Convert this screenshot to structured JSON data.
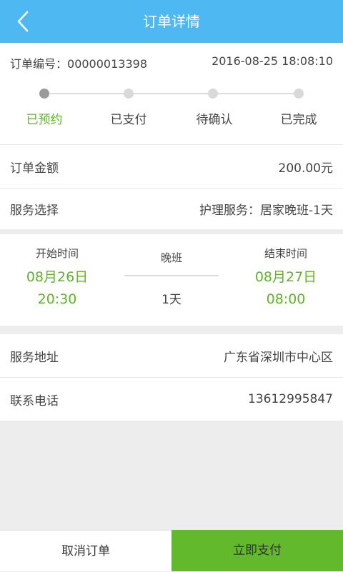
{
  "header": {
    "title": "订单详情"
  },
  "order": {
    "number_label": "订单编号：",
    "number": "00000013398",
    "datetime": "2016-08-25 18:08:10"
  },
  "progress": {
    "steps": [
      "已预约",
      "已支付",
      "待确认",
      "已完成"
    ],
    "current_index": 0
  },
  "amount": {
    "label": "订单金额",
    "value": "200.00元"
  },
  "service": {
    "label": "服务选择",
    "value": "护理服务：居家晚班-1天"
  },
  "schedule": {
    "start_label": "开始时间",
    "start_date": "08月26日",
    "start_time": "20:30",
    "shift": "晚班",
    "duration": "1天",
    "end_label": "结束时间",
    "end_date": "08月27日",
    "end_time": "08:00"
  },
  "address": {
    "label": "服务地址",
    "value": "广东省深圳市中心区"
  },
  "phone": {
    "label": "联系电话",
    "value": "13612995847"
  },
  "actions": {
    "cancel_label": "取消订单",
    "pay_label": "立即支付"
  },
  "colors": {
    "header": "#4db8f2",
    "accent_green": "#5cb524",
    "pay_button": "#62b92c"
  }
}
